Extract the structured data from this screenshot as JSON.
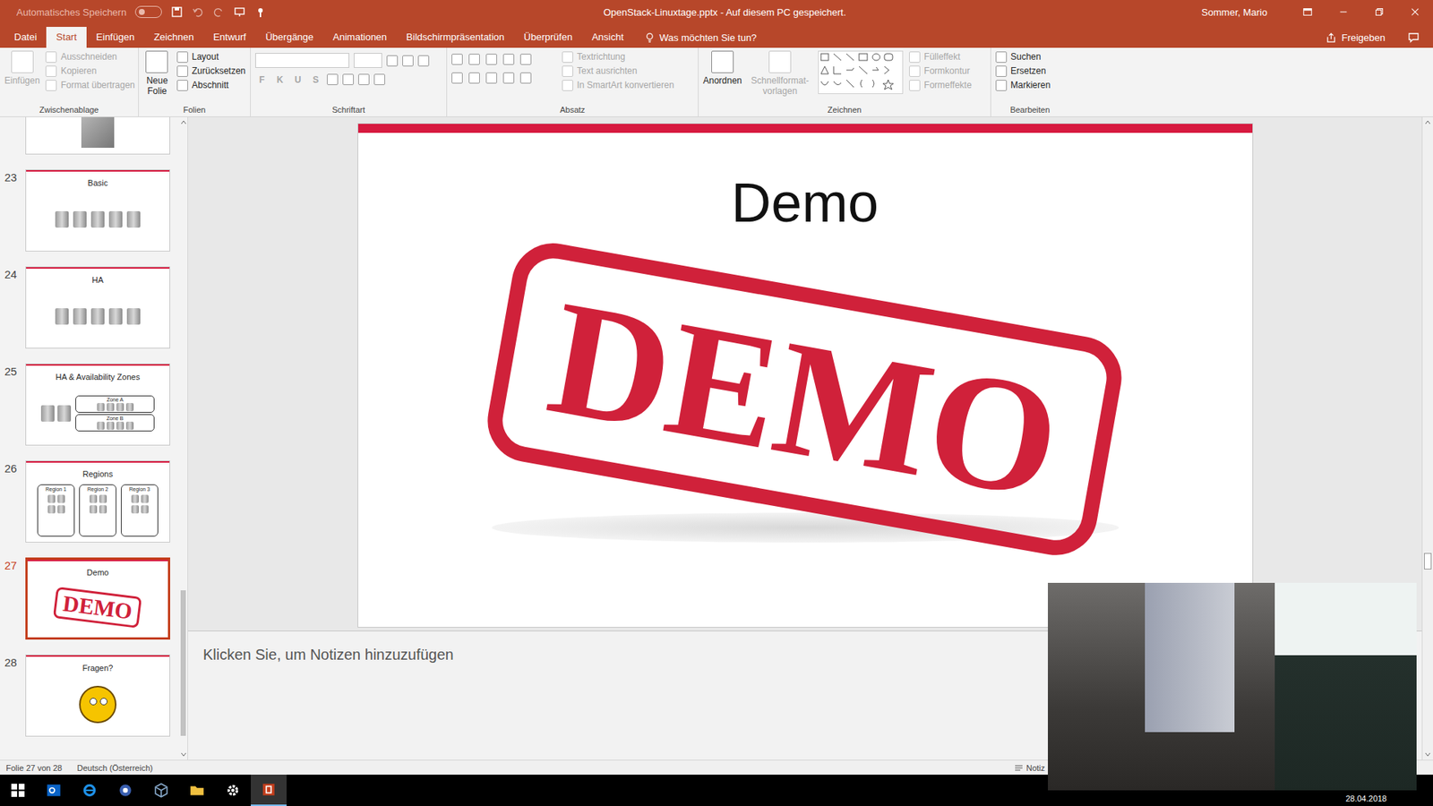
{
  "window": {
    "title": "OpenStack-Linuxtage.pptx - Auf diesem PC gespeichert.",
    "autosave": "Automatisches Speichern",
    "autosave_on": false,
    "user": "Sommer, Mario"
  },
  "tabs": [
    {
      "label": "Datei",
      "selected": false
    },
    {
      "label": "Start",
      "selected": true
    },
    {
      "label": "Einfügen",
      "selected": false
    },
    {
      "label": "Zeichnen",
      "selected": false
    },
    {
      "label": "Entwurf",
      "selected": false
    },
    {
      "label": "Übergänge",
      "selected": false
    },
    {
      "label": "Animationen",
      "selected": false
    },
    {
      "label": "Bildschirmpräsentation",
      "selected": false
    },
    {
      "label": "Überprüfen",
      "selected": false
    },
    {
      "label": "Ansicht",
      "selected": false
    }
  ],
  "tell_me": "Was möchten Sie tun?",
  "share": "Freigeben",
  "ribbon": {
    "groups": [
      {
        "kind": "clipboard",
        "label": "Zwischenablage",
        "big": [
          {
            "label": "Einfügen",
            "disabled": true
          }
        ],
        "items": [
          {
            "label": "Ausschneiden",
            "disabled": true
          },
          {
            "label": "Kopieren",
            "disabled": true
          },
          {
            "label": "Format übertragen",
            "disabled": true
          }
        ]
      },
      {
        "kind": "slides",
        "label": "Folien",
        "big": [
          {
            "label": "Neue Folie",
            "disabled": false
          }
        ],
        "items": [
          {
            "label": "Layout",
            "disabled": false
          },
          {
            "label": "Zurücksetzen",
            "disabled": false
          },
          {
            "label": "Abschnitt",
            "disabled": false
          }
        ]
      },
      {
        "kind": "font",
        "label": "Schriftart",
        "big": [],
        "items": [
          {
            "label": "F",
            "disabled": true
          },
          {
            "label": "K",
            "disabled": true
          },
          {
            "label": "U",
            "disabled": true
          },
          {
            "label": "S",
            "disabled": true
          }
        ]
      },
      {
        "kind": "paragraph",
        "label": "Absatz",
        "big": [],
        "items": [
          {
            "label": "Textrichtung",
            "disabled": true
          },
          {
            "label": "Text ausrichten",
            "disabled": true
          },
          {
            "label": "In SmartArt konvertieren",
            "disabled": true
          }
        ]
      },
      {
        "kind": "drawing",
        "label": "Zeichnen",
        "big": [
          {
            "label": "Anordnen",
            "disabled": false
          },
          {
            "label": "Schnellformat-vorlagen",
            "disabled": true
          }
        ],
        "items": [
          {
            "label": "Fülleffekt",
            "disabled": true
          },
          {
            "label": "Formkontur",
            "disabled": true
          },
          {
            "label": "Formeffekte",
            "disabled": true
          }
        ]
      },
      {
        "kind": "editing",
        "label": "Bearbeiten",
        "big": [],
        "items": [
          {
            "label": "Suchen",
            "disabled": false
          },
          {
            "label": "Ersetzen",
            "disabled": false
          },
          {
            "label": "Markieren",
            "disabled": false
          }
        ]
      }
    ]
  },
  "thumbnails": [
    {
      "number": "23",
      "title": "Basic",
      "kind": "servers",
      "labels": [],
      "selected": false
    },
    {
      "number": "24",
      "title": "HA",
      "kind": "servers",
      "labels": [],
      "selected": false
    },
    {
      "number": "25",
      "title": "HA & Availability Zones",
      "kind": "zones",
      "labels": [
        "Zone A",
        "Zone B"
      ],
      "selected": false
    },
    {
      "number": "26",
      "title": "Regions",
      "kind": "regions",
      "labels": [
        "Region 1",
        "Region 2",
        "Region 3"
      ],
      "selected": false
    },
    {
      "number": "27",
      "title": "Demo",
      "kind": "stamp",
      "labels": [
        "DEMO"
      ],
      "selected": true
    },
    {
      "number": "28",
      "title": "Fragen?",
      "kind": "question",
      "labels": [],
      "selected": false
    }
  ],
  "slide": {
    "title": "Demo",
    "stamp": "DEMO"
  },
  "notes": {
    "placeholder": "Klicken Sie, um Notizen hinzuzufügen"
  },
  "status_bar": {
    "slide": "Folie 27 von 28",
    "language": "Deutsch (Österreich)",
    "notes": "Notiz"
  },
  "taskbar": {
    "date": "28.04.2018"
  }
}
